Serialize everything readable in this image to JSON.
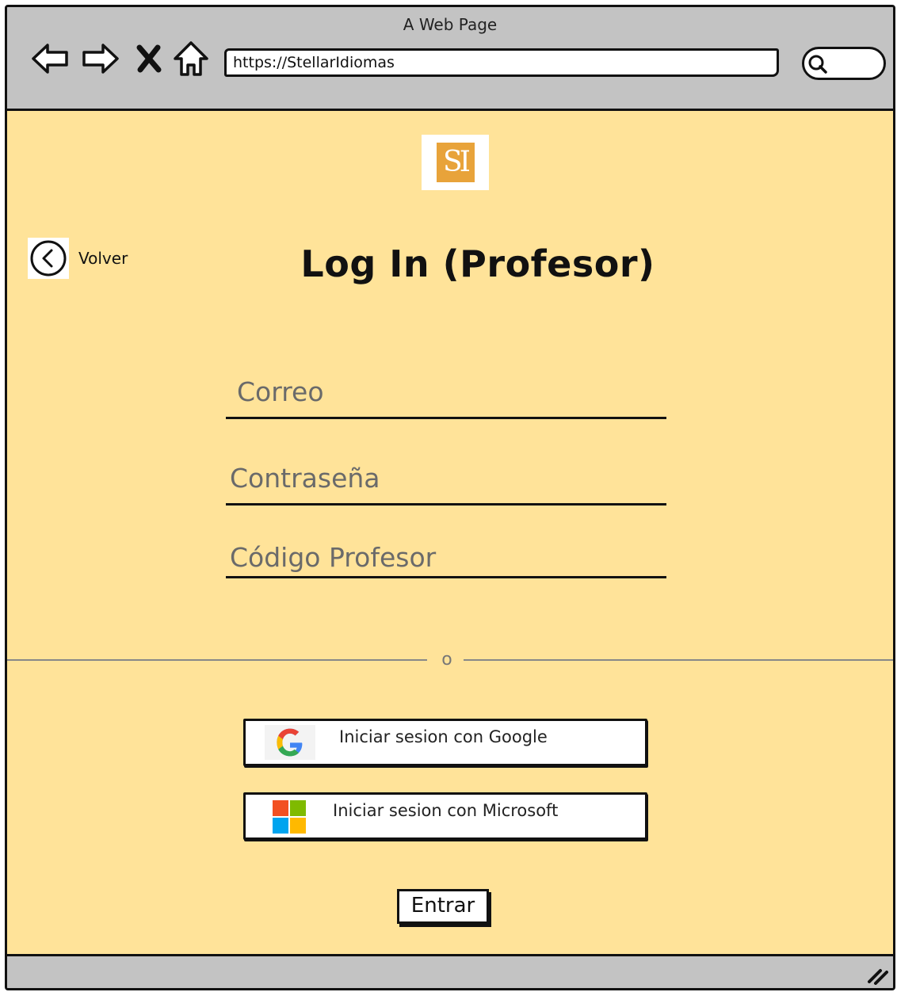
{
  "window": {
    "title": "A Web Page",
    "url": "https://StellarIdiomas"
  },
  "nav_icons": [
    "back-arrow-icon",
    "forward-arrow-icon",
    "close-icon",
    "home-icon",
    "search-icon"
  ],
  "logo": {
    "text": "SI",
    "color": "#e8a33a"
  },
  "back_link": {
    "label": "Volver",
    "icon": "chevron-left-icon"
  },
  "page": {
    "title": "Log In (Profesor)",
    "background": "#ffe399"
  },
  "form": {
    "email_placeholder": "Correo",
    "password_placeholder": "Contraseña",
    "code_placeholder": "Código Profesor"
  },
  "divider": {
    "text": "o"
  },
  "social": {
    "google_label": "Iniciar sesion  con Google",
    "microsoft_label": "Iniciar sesion con Microsoft"
  },
  "submit": {
    "label": "Entrar"
  }
}
